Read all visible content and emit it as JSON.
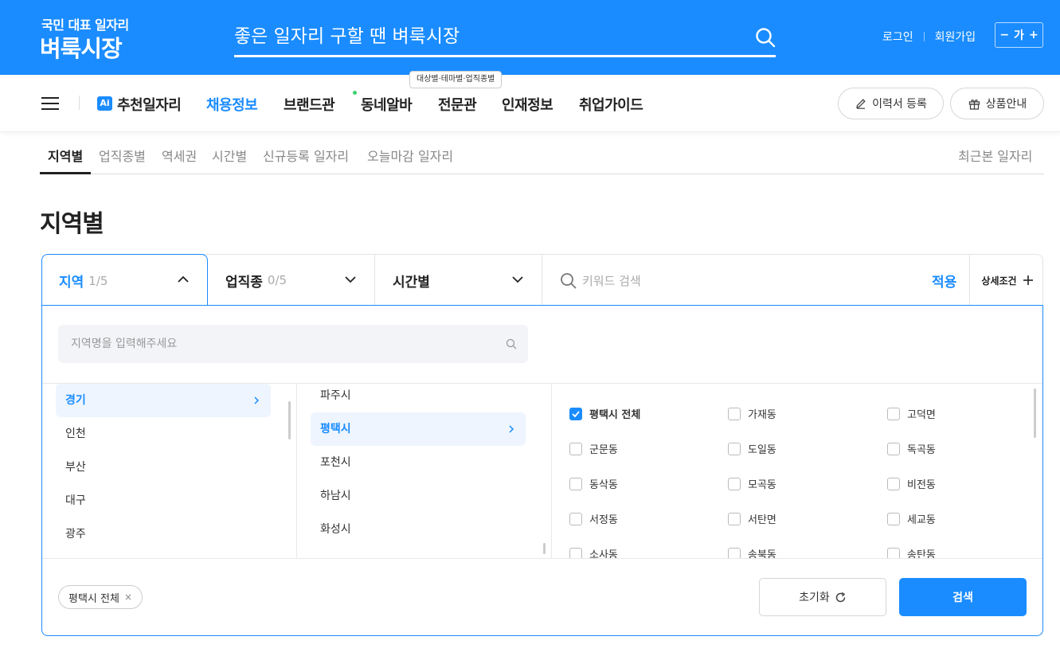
{
  "brand": {
    "tagline": "국민 대표 일자리",
    "name": "벼룩시장"
  },
  "header": {
    "search_placeholder": "좋은 일자리 구할 땐 벼룩시장",
    "login": "로그인",
    "signup": "회원가입",
    "font_size_label": "가",
    "font_minus": "−",
    "font_plus": "+"
  },
  "nav": {
    "ai_badge": "Ai",
    "items": [
      "추천일자리",
      "채용정보",
      "브랜드관",
      "동네알바",
      "전문관",
      "인재정보",
      "취업가이드"
    ],
    "active": "채용정보",
    "tooltip": "대상별·테마별·업직종별",
    "resume_btn": "이력서 등록",
    "product_btn": "상품안내"
  },
  "subtabs": {
    "items": [
      "지역별",
      "업직종별",
      "역세권",
      "시간별",
      "신규등록 일자리",
      "오늘마감 일자리"
    ],
    "recent": "최근본 일자리"
  },
  "page_title": "지역별",
  "filter": {
    "region_label": "지역",
    "region_count": "1/5",
    "job_label": "업직종",
    "job_count": "0/5",
    "time_label": "시간별",
    "keyword_placeholder": "키워드 검색",
    "apply": "적용",
    "detail": "상세조건"
  },
  "panel": {
    "region_search_placeholder": "지역명을 입력해주세요",
    "provinces": [
      "경기",
      "인천",
      "부산",
      "대구",
      "광주"
    ],
    "selected_province": "경기",
    "cities": [
      "파주시",
      "평택시",
      "포천시",
      "하남시",
      "화성시"
    ],
    "selected_city": "평택시",
    "districts": [
      [
        "평택시 전체",
        "가재동",
        "고덕면"
      ],
      [
        "군문동",
        "도일동",
        "독곡동"
      ],
      [
        "동삭동",
        "모곡동",
        "비전동"
      ],
      [
        "서정동",
        "서탄면",
        "세교동"
      ],
      [
        "소사동",
        "송북동",
        "송탄동"
      ]
    ],
    "checked": "평택시 전체",
    "chip": "평택시 전체",
    "chip_close": "×",
    "reset": "초기화",
    "search": "검색"
  },
  "colors": {
    "brand_blue": "#1a8cff",
    "dot_green": "#3bd16f"
  }
}
